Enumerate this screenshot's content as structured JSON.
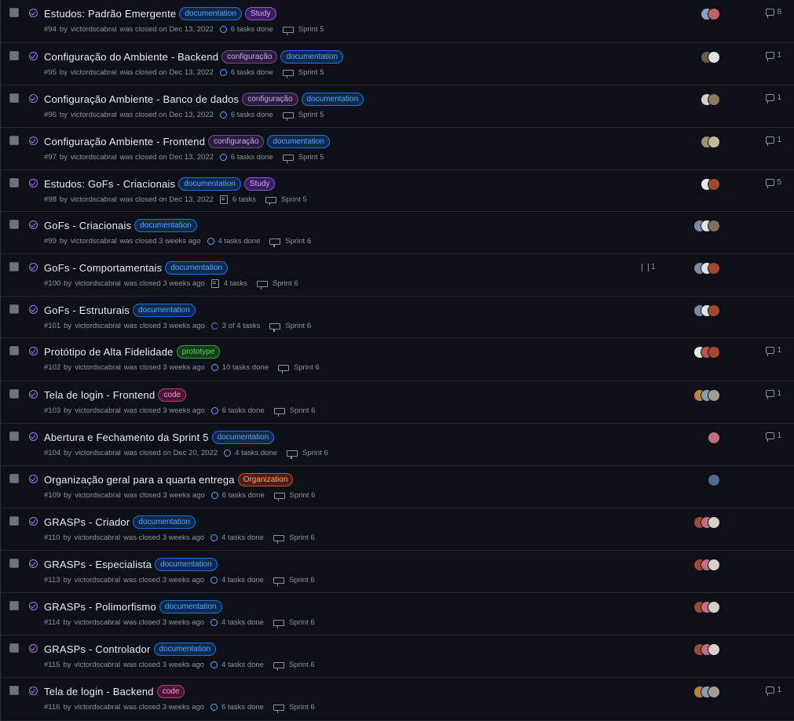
{
  "issues": [
    {
      "title": "Estudos: Padrão Emergente",
      "labels": [
        {
          "text": "documentation",
          "kind": "doc"
        },
        {
          "text": "Study",
          "kind": "study"
        }
      ],
      "number": "#94",
      "author": "victordscabral",
      "closed_text": "was closed on Dec 13, 2022",
      "tasks": "6 tasks done",
      "task_style": "done",
      "milestone": "Sprint 5",
      "comments": "8",
      "avatars": [
        "#8aa0c4",
        "#c06060"
      ]
    },
    {
      "title": "Configuração do Ambiente - Backend",
      "labels": [
        {
          "text": "configuração",
          "kind": "config"
        },
        {
          "text": "documentation",
          "kind": "doc"
        }
      ],
      "number": "#95",
      "author": "victordscabral",
      "closed_text": "was closed on Dec 13, 2022",
      "tasks": "6 tasks done",
      "task_style": "done",
      "milestone": "Sprint 5",
      "comments": "1",
      "avatars": [
        "#6b5a4a",
        "#e0e0e0"
      ]
    },
    {
      "title": "Configuração Ambiente - Banco de dados",
      "labels": [
        {
          "text": "configuração",
          "kind": "config"
        },
        {
          "text": "documentation",
          "kind": "doc"
        }
      ],
      "number": "#96",
      "author": "victordscabral",
      "closed_text": "was closed on Dec 13, 2022",
      "tasks": "6 tasks done",
      "task_style": "done",
      "milestone": "Sprint 5",
      "comments": "1",
      "avatars": [
        "#d8d0c8",
        "#8a7a60"
      ]
    },
    {
      "title": "Configuração Ambiente - Frontend",
      "labels": [
        {
          "text": "configuração",
          "kind": "config"
        },
        {
          "text": "documentation",
          "kind": "doc"
        }
      ],
      "number": "#97",
      "author": "victordscabral",
      "closed_text": "was closed on Dec 13, 2022",
      "tasks": "6 tasks done",
      "task_style": "done",
      "milestone": "Sprint 5",
      "comments": "1",
      "avatars": [
        "#a09070",
        "#c0b8a0"
      ]
    },
    {
      "title": "Estudos: GoFs - Criacionais",
      "labels": [
        {
          "text": "documentation",
          "kind": "doc"
        },
        {
          "text": "Study",
          "kind": "study"
        }
      ],
      "number": "#98",
      "author": "victordscabral",
      "closed_text": "was closed on Dec 13, 2022",
      "tasks": "6 tasks",
      "task_style": "checklist",
      "milestone": "Sprint 5",
      "comments": "5",
      "avatars": [
        "#e8e8e8",
        "#a04a30"
      ]
    },
    {
      "title": "GoFs - Criacionais",
      "labels": [
        {
          "text": "documentation",
          "kind": "doc"
        }
      ],
      "number": "#99",
      "author": "victordscabral",
      "closed_text": "was closed 3 weeks ago",
      "tasks": "4 tasks done",
      "task_style": "done",
      "milestone": "Sprint 6",
      "comments": "",
      "avatars": [
        "#7a8aa0",
        "#e0e0e0",
        "#807060"
      ]
    },
    {
      "title": "GoFs - Comportamentais",
      "labels": [
        {
          "text": "documentation",
          "kind": "doc"
        }
      ],
      "number": "#100",
      "author": "victordscabral",
      "closed_text": "was closed 3 weeks ago",
      "tasks": "4 tasks",
      "task_style": "checklist",
      "milestone": "Sprint 6",
      "comments": "",
      "avatars": [
        "#7a8aa0",
        "#e0e0e0",
        "#a04a30"
      ]
    },
    {
      "title": "GoFs - Estruturais",
      "labels": [
        {
          "text": "documentation",
          "kind": "doc"
        }
      ],
      "number": "#101",
      "author": "victordscabral",
      "closed_text": "was closed 3 weeks ago",
      "tasks": "3 of 4 tasks",
      "task_style": "partial",
      "milestone": "Sprint 6",
      "comments": "",
      "avatars": [
        "#7a8aa0",
        "#e0e0e0",
        "#a04a30"
      ]
    },
    {
      "title": "Protótipo de Alta Fidelidade",
      "labels": [
        {
          "text": "prototype",
          "kind": "proto"
        }
      ],
      "number": "#102",
      "author": "victordscabral",
      "closed_text": "was closed 3 weeks ago",
      "tasks": "10 tasks done",
      "task_style": "done",
      "milestone": "Sprint 6",
      "comments": "1",
      "avatars": [
        "#e8e8e8",
        "#c05050",
        "#a04a30"
      ]
    },
    {
      "title": "Tela de login - Frontend",
      "labels": [
        {
          "text": "code",
          "kind": "code"
        }
      ],
      "number": "#103",
      "author": "victordscabral",
      "closed_text": "was closed 3 weeks ago",
      "tasks": "6 tasks done",
      "task_style": "done",
      "milestone": "Sprint 6",
      "comments": "1",
      "avatars": [
        "#c08040",
        "#8a9ab0",
        "#a0a090"
      ]
    },
    {
      "title": "Abertura e Fechamento da Sprint 5",
      "labels": [
        {
          "text": "documentation",
          "kind": "doc"
        }
      ],
      "number": "#104",
      "author": "victordscabral",
      "closed_text": "was closed on Dec 20, 2022",
      "tasks": "4 tasks done",
      "task_style": "done",
      "milestone": "Sprint 6",
      "comments": "1",
      "avatars": [
        "#c07080"
      ]
    },
    {
      "title": "Organização geral para a quarta entrega",
      "labels": [
        {
          "text": "Organization",
          "kind": "org"
        }
      ],
      "number": "#109",
      "author": "victordscabral",
      "closed_text": "was closed 3 weeks ago",
      "tasks": "6 tasks done",
      "task_style": "done",
      "milestone": "Sprint 6",
      "comments": "",
      "avatars": [
        "#506a90"
      ]
    },
    {
      "title": "GRASPs - Criador",
      "labels": [
        {
          "text": "documentation",
          "kind": "doc"
        }
      ],
      "number": "#110",
      "author": "victordscabral",
      "closed_text": "was closed 3 weeks ago",
      "tasks": "4 tasks done",
      "task_style": "done",
      "milestone": "Sprint 6",
      "comments": "",
      "avatars": [
        "#a04a30",
        "#c07080",
        "#d8d0c8"
      ]
    },
    {
      "title": "GRASPs - Especialista",
      "labels": [
        {
          "text": "documentation",
          "kind": "doc"
        }
      ],
      "number": "#113",
      "author": "victordscabral",
      "closed_text": "was closed 3 weeks ago",
      "tasks": "4 tasks done",
      "task_style": "done",
      "milestone": "Sprint 6",
      "comments": "",
      "avatars": [
        "#a04a30",
        "#c07080",
        "#d8d0c8"
      ]
    },
    {
      "title": "GRASPs - Polimorfismo",
      "labels": [
        {
          "text": "documentation",
          "kind": "doc"
        }
      ],
      "number": "#114",
      "author": "victordscabral",
      "closed_text": "was closed 3 weeks ago",
      "tasks": "4 tasks done",
      "task_style": "done",
      "milestone": "Sprint 6",
      "comments": "",
      "avatars": [
        "#a04a30",
        "#c07080",
        "#d8d0c8"
      ]
    },
    {
      "title": "GRASPs - Controlador",
      "labels": [
        {
          "text": "documentation",
          "kind": "doc"
        }
      ],
      "number": "#115",
      "author": "victordscabral",
      "closed_text": "was closed 3 weeks ago",
      "tasks": "4 tasks done",
      "task_style": "done",
      "milestone": "Sprint 6",
      "comments": "",
      "avatars": [
        "#a04a30",
        "#c07080",
        "#d8d0c8"
      ]
    },
    {
      "title": "Tela de login - Backend",
      "labels": [
        {
          "text": "code",
          "kind": "code"
        }
      ],
      "number": "#116",
      "author": "victordscabral",
      "closed_text": "was closed 3 weeks ago",
      "tasks": "6 tasks done",
      "task_style": "done",
      "milestone": "Sprint 6",
      "comments": "1",
      "avatars": [
        "#c08040",
        "#8a9ab0",
        "#a0a090"
      ]
    }
  ],
  "linked_pr_count": "1"
}
